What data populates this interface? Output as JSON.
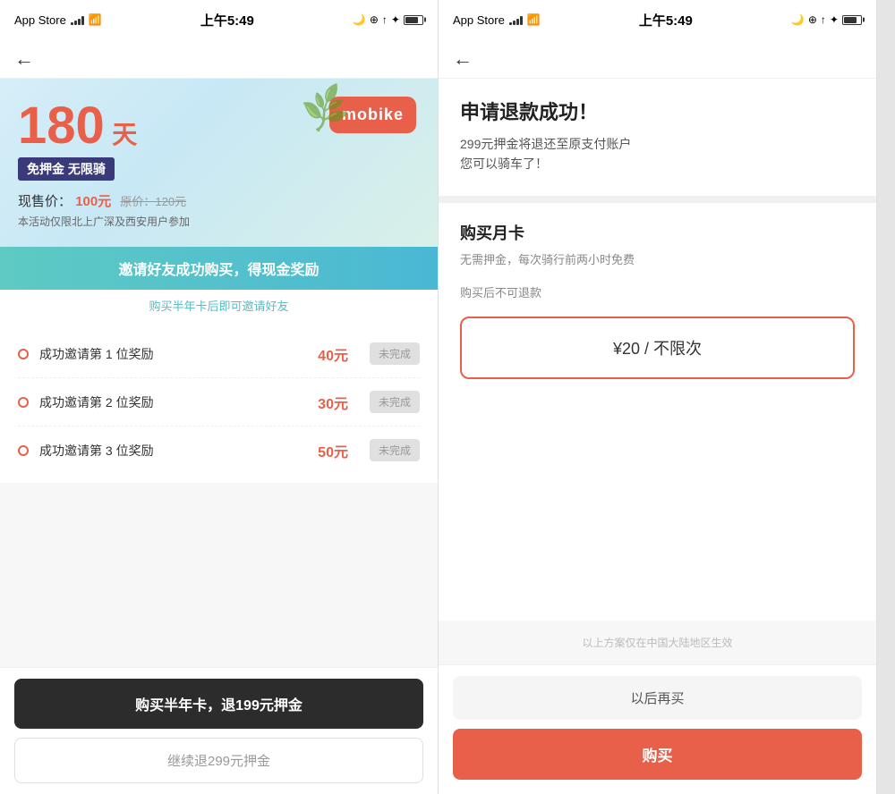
{
  "panel1": {
    "statusBar": {
      "appName": "App Store",
      "time": "上午5:49",
      "signalLabel": "signal",
      "wifiLabel": "wifi",
      "batteryLabel": "battery"
    },
    "nav": {
      "backLabel": "←"
    },
    "hero": {
      "days": "180",
      "daysUnit": "天",
      "tag": "免押金 无限骑",
      "priceLabel": "现售价：",
      "priceValue": "100元",
      "originalLabel": "原价：120元",
      "note": "本活动仅限北上广深及西安用户参加",
      "logoText": "mobike"
    },
    "inviteBanner": {
      "main": "邀请好友成功购买，得现金奖励",
      "sub": "购买半年卡后即可邀请好友"
    },
    "rewards": [
      {
        "label": "成功邀请第 1 位奖励",
        "amount": "40元",
        "status": "未完成"
      },
      {
        "label": "成功邀请第 2 位奖励",
        "amount": "30元",
        "status": "未完成"
      },
      {
        "label": "成功邀请第 3 位奖励",
        "amount": "50元",
        "status": "未完成"
      }
    ],
    "buttons": {
      "primary": "购买半年卡，退199元押金",
      "secondary": "继续退299元押金"
    }
  },
  "panel2": {
    "statusBar": {
      "appName": "App Store",
      "time": "上午5:49"
    },
    "nav": {
      "backLabel": "←"
    },
    "success": {
      "title": "申请退款成功！",
      "desc1": "299元押金将退还至原支付账户",
      "desc2": "您可以骑车了！"
    },
    "monthly": {
      "title": "购买月卡",
      "desc1": "无需押金，每次骑行前两小时免费",
      "desc2": "购买后不可退款",
      "cardText": "¥20 / 不限次"
    },
    "disclaimer": "以上方案仅在中国大陆地区生效",
    "buttons": {
      "later": "以后再买",
      "buy": "购买"
    }
  }
}
